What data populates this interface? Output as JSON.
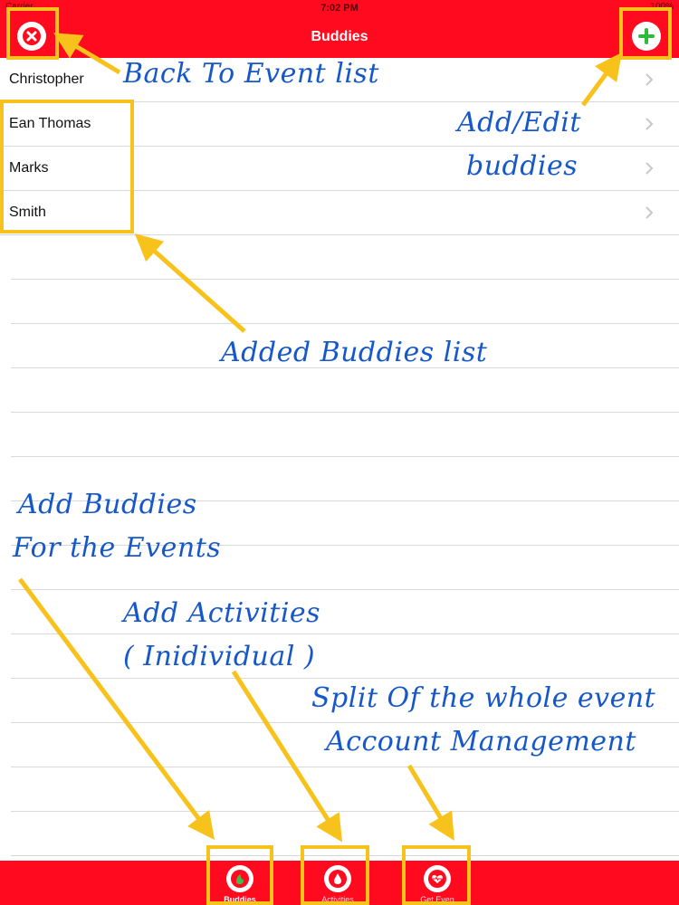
{
  "status": {
    "carrier": "Carrier",
    "time": "7:02 PM",
    "battery": "100%"
  },
  "nav": {
    "title": "Buddies",
    "left_icon": "close-icon",
    "right_icon": "plus-icon"
  },
  "buddies": [
    {
      "name": "Christopher"
    },
    {
      "name": "Ean Thomas"
    },
    {
      "name": "Marks"
    },
    {
      "name": "Smith"
    }
  ],
  "tabs": [
    {
      "label": "Buddies",
      "icon": "buddies-icon",
      "active": true
    },
    {
      "label": "Activities",
      "icon": "activities-icon",
      "active": false
    },
    {
      "label": "Get Even",
      "icon": "heart-icon",
      "active": false
    }
  ],
  "annotations": {
    "back": "Back To Event list",
    "add_edit_1": "Add/Edit",
    "add_edit_2": "buddies",
    "added_list": "Added Buddies list",
    "add_buddies_1": "Add Buddies",
    "add_buddies_2": "For the Events",
    "add_activities_1": "Add Activities",
    "add_activities_2": "( Inidividual )",
    "split_1": "Split Of the whole event",
    "split_2": "Account Management"
  },
  "colors": {
    "brand_red": "#ff0a1e",
    "annotation_blue": "#1658c9",
    "annotation_yellow": "#f7c21b"
  }
}
